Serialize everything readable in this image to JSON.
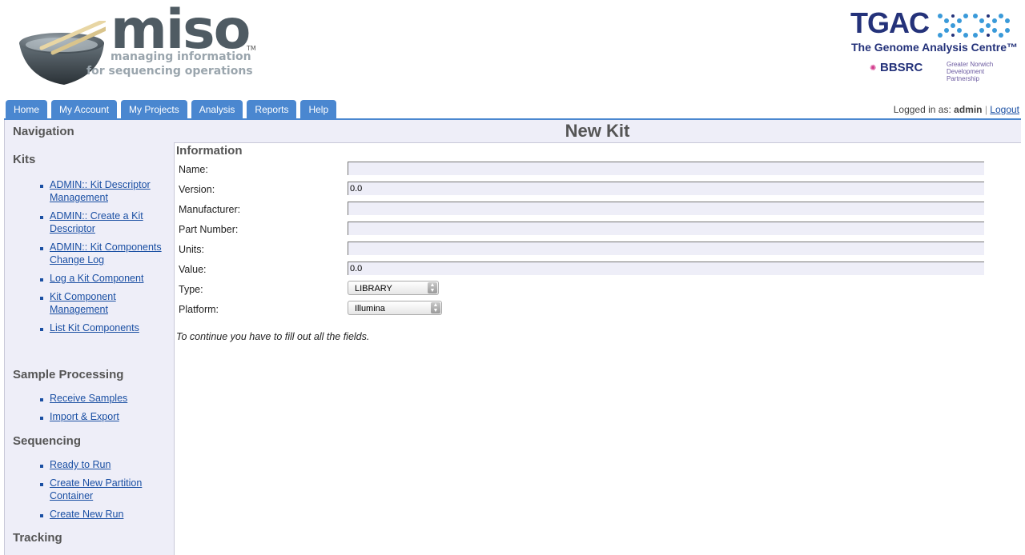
{
  "header": {
    "app_name": "miso",
    "trademark": "TM",
    "tagline_1": "managing information",
    "tagline_2": "for sequencing operations",
    "partner_name": "TGAC",
    "partner_full": "The Genome Analysis Centre™",
    "partner_2": "BBSRC",
    "partner_3": "Greater Norwich Development Partnership"
  },
  "tabs": [
    {
      "label": "Home"
    },
    {
      "label": "My Account"
    },
    {
      "label": "My Projects"
    },
    {
      "label": "Analysis"
    },
    {
      "label": "Reports"
    },
    {
      "label": "Help"
    }
  ],
  "session": {
    "logged_in_label": "Logged in as:",
    "username": "admin",
    "separator": "|",
    "logout_label": "Logout"
  },
  "sidebar": {
    "heading": "Navigation",
    "sections": [
      {
        "title": "Kits",
        "items": [
          "ADMIN:: Kit Descriptor Management",
          "ADMIN:: Create a Kit Descriptor",
          "ADMIN:: Kit Components Change Log",
          "Log a Kit Component",
          "Kit Component Management",
          "List Kit Components"
        ]
      },
      {
        "title": "Sample Processing",
        "items": [
          "Receive Samples",
          "Import & Export"
        ]
      },
      {
        "title": "Sequencing",
        "items": [
          "Ready to Run",
          "Create New Partition Container",
          "Create New Run"
        ]
      },
      {
        "title": "Tracking",
        "items": []
      }
    ]
  },
  "main": {
    "page_title": "New Kit",
    "section_title": "Information",
    "fields": [
      {
        "label": "Name:",
        "value": ""
      },
      {
        "label": "Version:",
        "value": "0.0"
      },
      {
        "label": "Manufacturer:",
        "value": ""
      },
      {
        "label": "Part Number:",
        "value": ""
      },
      {
        "label": "Units:",
        "value": ""
      },
      {
        "label": "Value:",
        "value": "0.0"
      },
      {
        "label": "Type:",
        "value": "LIBRARY"
      },
      {
        "label": "Platform:",
        "value": "Illumina"
      }
    ],
    "note": "To continue you have to fill out all the fields."
  }
}
